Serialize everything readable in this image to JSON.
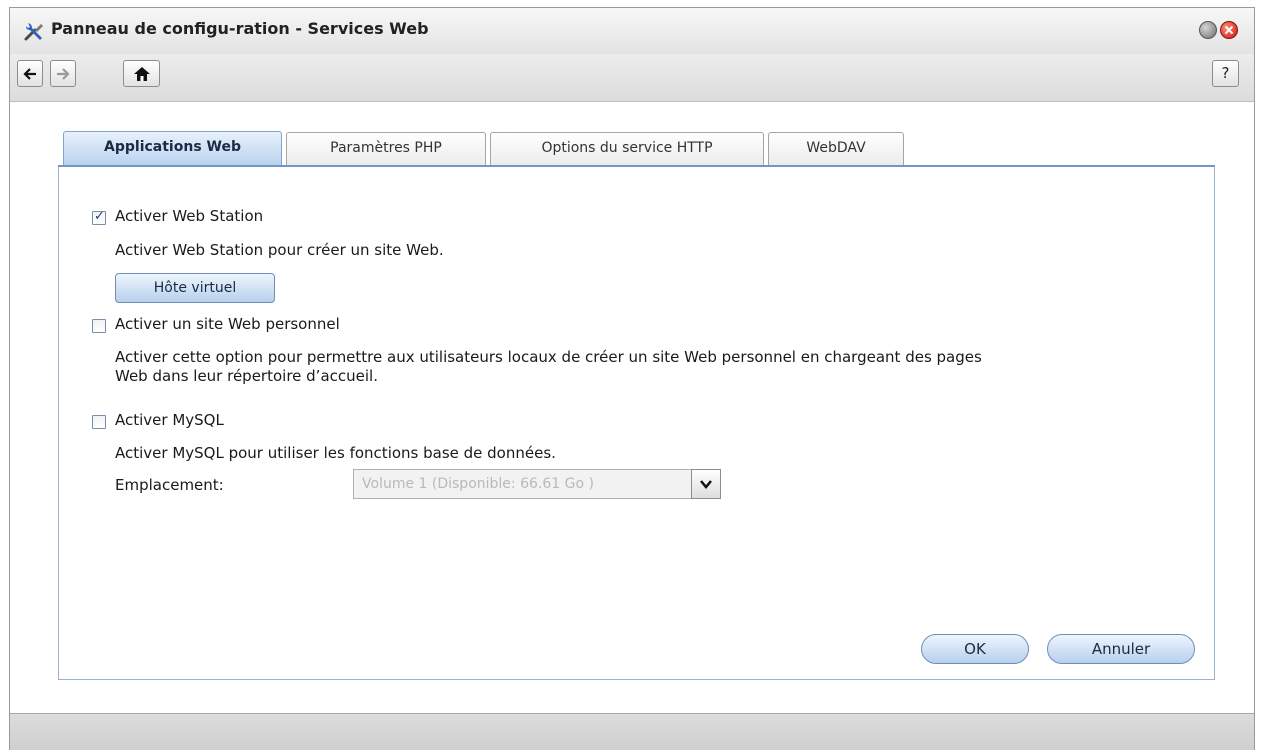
{
  "window": {
    "title": "Panneau de configu-ration - Services Web"
  },
  "toolbar": {
    "back_icon": "arrow-left-icon",
    "forward_icon": "arrow-right-icon",
    "home_icon": "home-icon",
    "help_label": "?"
  },
  "tabs": [
    {
      "label": "Applications Web",
      "active": true
    },
    {
      "label": "Paramètres PHP",
      "active": false
    },
    {
      "label": "Options du service HTTP",
      "active": false
    },
    {
      "label": "WebDAV",
      "active": false
    }
  ],
  "options": {
    "web_station": {
      "label": "Activer Web Station",
      "checked": true,
      "description": "Activer Web Station pour créer un site Web.",
      "button_label": "Hôte virtuel"
    },
    "personal_site": {
      "label": "Activer un site Web personnel",
      "checked": false,
      "description_line1": "Activer cette option pour permettre aux utilisateurs locaux de créer un site Web personnel en chargeant des pages",
      "description_line2": "Web dans leur répertoire d’accueil."
    },
    "mysql": {
      "label": "Activer MySQL",
      "checked": false,
      "description": "Activer MySQL pour utiliser les fonctions base de données.",
      "location_label": "Emplacement:",
      "location_value": "Volume 1 (Disponible: 66.61 Go )"
    }
  },
  "actions": {
    "ok_label": "OK",
    "cancel_label": "Annuler"
  },
  "colors": {
    "tab_active_accent": "#b9d2ef",
    "panel_border": "#6f98c7",
    "close_button": "#c8150f"
  }
}
